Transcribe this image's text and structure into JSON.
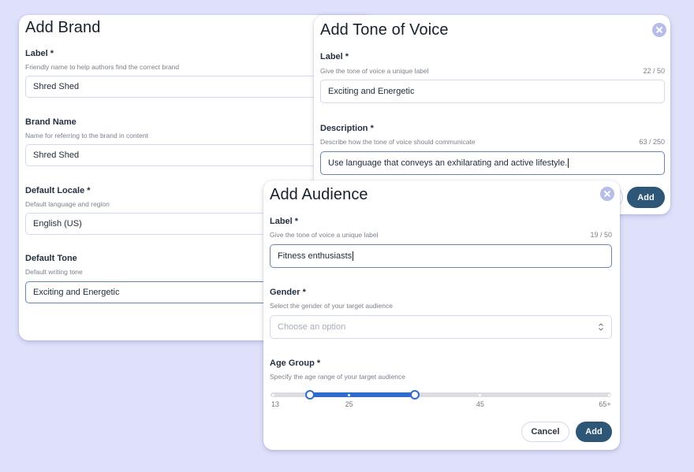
{
  "brand_dialog": {
    "title": "Add Brand",
    "fields": [
      {
        "label": "Label *",
        "help": "Friendly name to help authors find the correct brand",
        "value": "Shred Shed"
      },
      {
        "label": "Brand Name",
        "help": "Name for referring to the brand in content",
        "value": "Shred Shed"
      },
      {
        "label": "Default Locale *",
        "help": "Default language and region",
        "value": "English (US)"
      },
      {
        "label": "Default Tone",
        "help": "Default writing tone",
        "value": "Exciting and Energetic"
      }
    ]
  },
  "tone_dialog": {
    "title": "Add Tone of Voice",
    "close_icon": "close-circle-icon",
    "fields": [
      {
        "label": "Label *",
        "help": "Give the tone of voice a unique label",
        "count": "22 / 50",
        "value": "Exciting and Energetic"
      },
      {
        "label": "Description *",
        "help": "Describe how the tone of voice should communicate",
        "count": "63 / 250",
        "value": "Use language that conveys an exhilarating and active lifestyle."
      }
    ],
    "add_label": "Add"
  },
  "audience_dialog": {
    "title": "Add Audience",
    "close_icon": "close-circle-icon",
    "label_field": {
      "label": "Label *",
      "help": "Give the tone of voice a unique label",
      "count": "19 / 50",
      "value": "Fitness enthusiasts"
    },
    "gender_field": {
      "label": "Gender *",
      "help": "Select the gender of your target audience",
      "placeholder": "Choose an option"
    },
    "age_field": {
      "label": "Age Group *",
      "help": "Specify the age range of your target audience",
      "min": 13,
      "max": 65,
      "range": [
        19,
        35
      ],
      "ticks": [
        {
          "value": 13,
          "label": "13"
        },
        {
          "value": 25,
          "label": "25"
        },
        {
          "value": 45,
          "label": "45"
        },
        {
          "value": 65,
          "label": "65+"
        }
      ]
    },
    "cancel_label": "Cancel",
    "add_label": "Add"
  },
  "colors": {
    "background": "#dfe1fb",
    "primary_button": "#2d5677",
    "slider_fill": "#2f6bce",
    "close_icon": "#b7bde9"
  }
}
